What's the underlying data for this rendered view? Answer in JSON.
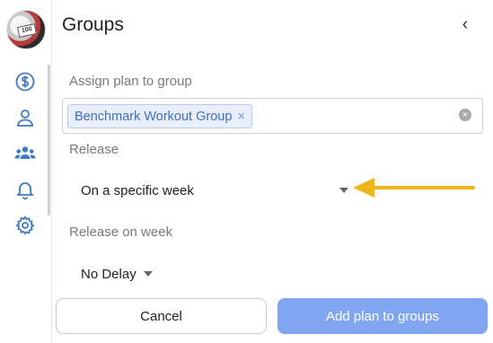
{
  "panel": {
    "title": "Groups",
    "collapse_glyph": "‹"
  },
  "sidebar": {
    "avatar_text": "100",
    "items": [
      {
        "name": "billing",
        "icon": "dollar-circle-icon"
      },
      {
        "name": "profile",
        "icon": "user-icon"
      },
      {
        "name": "groups",
        "icon": "users-icon",
        "active": true
      },
      {
        "name": "notifications",
        "icon": "bell-icon"
      },
      {
        "name": "settings",
        "icon": "gear-icon"
      }
    ]
  },
  "assign": {
    "label": "Assign plan to group",
    "selected_tags": [
      "Benchmark Workout Group"
    ],
    "tag_remove_glyph": "×",
    "clear_glyph": "×"
  },
  "release": {
    "label": "Release",
    "value": "On a specific week"
  },
  "release_week": {
    "label": "Release on week",
    "value": "No Delay"
  },
  "actions": {
    "cancel_label": "Cancel",
    "submit_label": "Add plan to groups"
  },
  "colors": {
    "accent": "#3f79c8",
    "submit_bg": "#80a6f2",
    "tag_bg": "#e8eefb",
    "annotation_arrow": "#f1b51c"
  }
}
